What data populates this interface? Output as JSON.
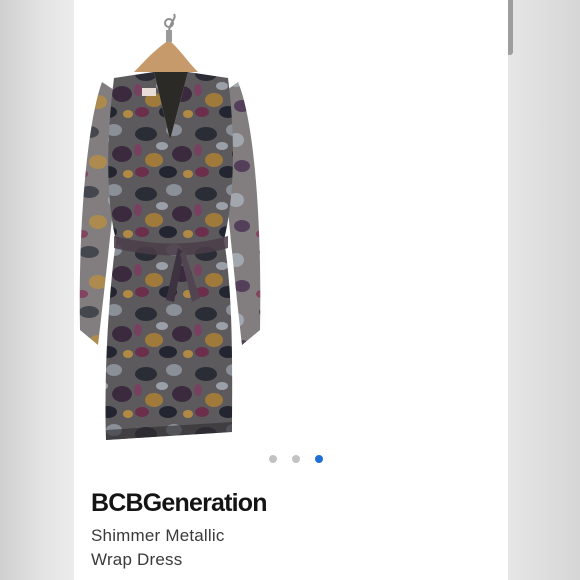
{
  "product": {
    "brand": "BCBGeneration",
    "name_line1": "Shimmer Metallic",
    "name_line2": "Wrap Dress"
  },
  "carousel": {
    "total": 3,
    "active_index": 2,
    "dot_colors": {
      "inactive": "#c2c2c2",
      "active": "#1f6fd6"
    }
  },
  "colors": {
    "page_background": "#ffffff",
    "brand_text": "#141414",
    "name_text": "#3a3a3a"
  },
  "icons": [
    "hanger-icon"
  ]
}
